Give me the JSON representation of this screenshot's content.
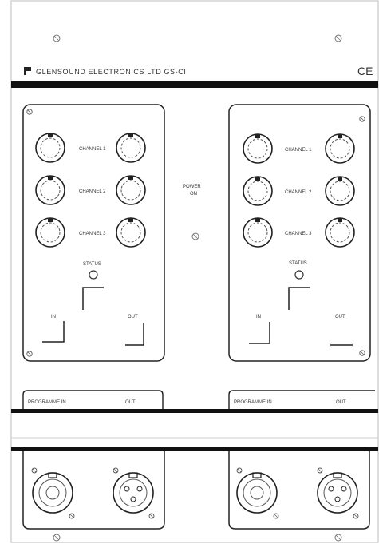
{
  "header": {
    "maker": "GLENSOUND ELECTRONICS LTD GS-CI",
    "ce_mark": "CE"
  },
  "left_panel": {
    "rows": [
      "CHANNEL 1",
      "CHANNEL 2",
      "CHANNEL 3"
    ],
    "status_label": "STATUS",
    "left_label": "IN",
    "right_label": "OUT"
  },
  "right_panel": {
    "rows": [
      "CHANNEL 1",
      "CHANNEL 2",
      "CHANNEL 3"
    ],
    "status_label": "STATUS",
    "left_label": "IN",
    "right_label": "OUT"
  },
  "center": {
    "label": "POWER",
    "sublabel": "ON"
  },
  "lower_strip": {
    "left": {
      "label1": "PROGRAMME IN",
      "label2": "OUT"
    },
    "right": {
      "label1": "PROGRAMME IN",
      "label2": "OUT"
    }
  },
  "icons": [
    "screw-icon",
    "flag-icon",
    "xlr-connector-icon",
    "ground-icon"
  ]
}
